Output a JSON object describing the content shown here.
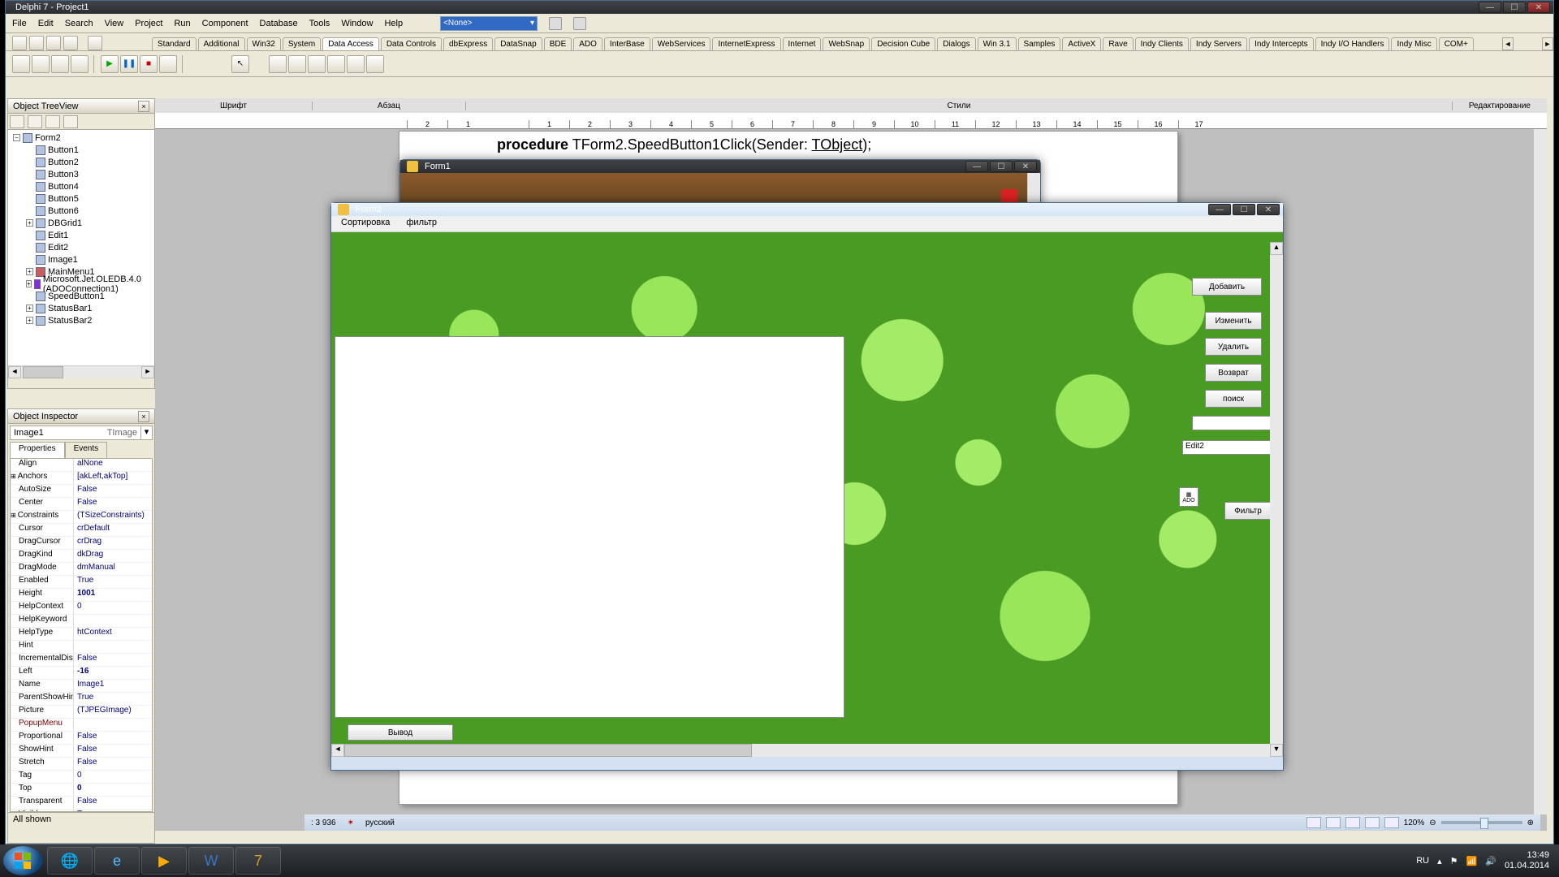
{
  "window": {
    "title": "Delphi 7 - Project1"
  },
  "menu": [
    "File",
    "Edit",
    "Search",
    "View",
    "Project",
    "Run",
    "Component",
    "Database",
    "Tools",
    "Window",
    "Help"
  ],
  "combo_value": "<None>",
  "palette_tabs": [
    "Standard",
    "Additional",
    "Win32",
    "System",
    "Data Access",
    "Data Controls",
    "dbExpress",
    "DataSnap",
    "BDE",
    "ADO",
    "InterBase",
    "WebServices",
    "InternetExpress",
    "Internet",
    "WebSnap",
    "Decision Cube",
    "Dialogs",
    "Win 3.1",
    "Samples",
    "ActiveX",
    "Rave",
    "Indy Clients",
    "Indy Servers",
    "Indy Intercepts",
    "Indy I/O Handlers",
    "Indy Misc",
    "COM+"
  ],
  "active_palette_tab": "Data Access",
  "sectionbar": {
    "font": "Шрифт",
    "para": "Абзац",
    "styles": "Стили",
    "edit": "Редактирование"
  },
  "code_line": {
    "kw": "procedure",
    "rest1": " TForm2.SpeedButton1Click(Sender: ",
    "cls": "TObject",
    "rest2": ");"
  },
  "treeview": {
    "title": "Object TreeView",
    "root": "Form2",
    "items": [
      "Button1",
      "Button2",
      "Button3",
      "Button4",
      "Button5",
      "Button6",
      "DBGrid1",
      "Edit1",
      "Edit2",
      "Image1",
      "MainMenu1",
      "Microsoft.Jet.OLEDB.4.0 (ADOConnection1)",
      "SpeedButton1",
      "StatusBar1",
      "StatusBar2"
    ]
  },
  "inspector": {
    "title": "Object Inspector",
    "component": "Image1",
    "ctype": "TImage",
    "tabs": [
      "Properties",
      "Events"
    ],
    "active_tab": "Properties",
    "props": [
      {
        "n": "Align",
        "v": "alNone"
      },
      {
        "n": "Anchors",
        "v": "[akLeft,akTop]",
        "ex": true
      },
      {
        "n": "AutoSize",
        "v": "False"
      },
      {
        "n": "Center",
        "v": "False"
      },
      {
        "n": "Constraints",
        "v": "(TSizeConstraints)",
        "ex": true
      },
      {
        "n": "Cursor",
        "v": "crDefault"
      },
      {
        "n": "DragCursor",
        "v": "crDrag"
      },
      {
        "n": "DragKind",
        "v": "dkDrag"
      },
      {
        "n": "DragMode",
        "v": "dmManual"
      },
      {
        "n": "Enabled",
        "v": "True"
      },
      {
        "n": "Height",
        "v": "1001",
        "bold": true
      },
      {
        "n": "HelpContext",
        "v": "0"
      },
      {
        "n": "HelpKeyword",
        "v": ""
      },
      {
        "n": "HelpType",
        "v": "htContext"
      },
      {
        "n": "Hint",
        "v": ""
      },
      {
        "n": "IncrementalDisplay",
        "v": "False"
      },
      {
        "n": "Left",
        "v": "-16",
        "bold": true
      },
      {
        "n": "Name",
        "v": "Image1"
      },
      {
        "n": "ParentShowHint",
        "v": "True"
      },
      {
        "n": "Picture",
        "v": "(TJPEGImage)"
      },
      {
        "n": "PopupMenu",
        "v": "",
        "red": true
      },
      {
        "n": "Proportional",
        "v": "False"
      },
      {
        "n": "ShowHint",
        "v": "False"
      },
      {
        "n": "Stretch",
        "v": "False"
      },
      {
        "n": "Tag",
        "v": "0"
      },
      {
        "n": "Top",
        "v": "0",
        "bold": true
      },
      {
        "n": "Transparent",
        "v": "False"
      },
      {
        "n": "Visible",
        "v": "True"
      }
    ],
    "footer": "All shown"
  },
  "form1": {
    "title": "Form1"
  },
  "form2": {
    "title": "Form2",
    "menu": [
      "Сортировка",
      "фильтр"
    ],
    "buttons": {
      "add": "Добавить",
      "edit": "Изменить",
      "del": "Удалить",
      "ret": "Возврат",
      "search": "поиск",
      "filter": "Фильтр",
      "exit": "Вывод"
    },
    "edit2_value": "Edit2",
    "ado_label": "ADO"
  },
  "wordstatus": {
    "words_label": ": 3 936",
    "lang": "русский",
    "zoom": "120%",
    "lang_ic": "RU"
  },
  "ruler": [
    "2",
    "1",
    "",
    "1",
    "2",
    "3",
    "4",
    "5",
    "6",
    "7",
    "8",
    "9",
    "10",
    "11",
    "12",
    "13",
    "14",
    "15",
    "16",
    "17"
  ],
  "tray": {
    "lang": "RU",
    "time": "13:49",
    "date": "01.04.2014"
  }
}
